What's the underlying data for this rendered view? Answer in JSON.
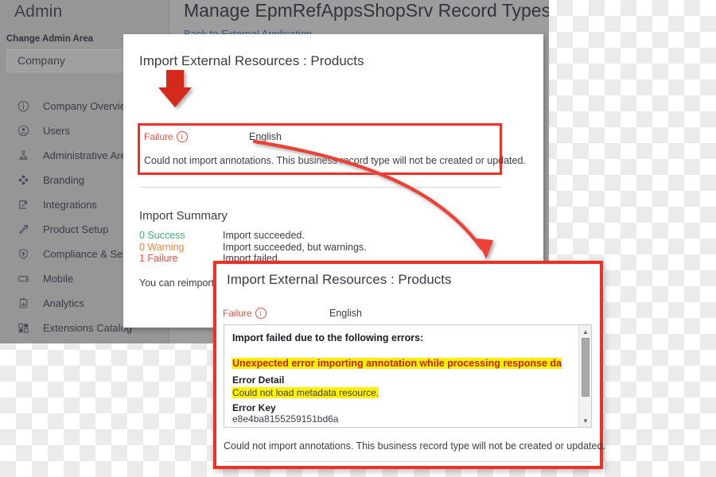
{
  "app": {
    "sidebar": {
      "title": "Admin",
      "change_area_label": "Change Admin Area",
      "area_select_value": "Company",
      "items": [
        {
          "label": "Company Overview",
          "icon": "info-circle-icon"
        },
        {
          "label": "Users",
          "icon": "user-circle-icon"
        },
        {
          "label": "Administrative Areas",
          "icon": "org-areas-icon"
        },
        {
          "label": "Branding",
          "icon": "branding-icon"
        },
        {
          "label": "Integrations",
          "icon": "integrations-icon"
        },
        {
          "label": "Product Setup",
          "icon": "wrench-icon"
        },
        {
          "label": "Compliance & Security",
          "icon": "shield-icon"
        },
        {
          "label": "Mobile",
          "icon": "mobile-icon"
        },
        {
          "label": "Analytics",
          "icon": "clipboard-chart-icon"
        },
        {
          "label": "Extensions Catalog",
          "icon": "extensions-grid-icon"
        }
      ]
    },
    "main": {
      "page_title": "Manage EpmRefAppsShopSrv  Record Types",
      "back_link": "Back to External Application"
    }
  },
  "upper_dialog": {
    "title": "Import External Resources : Products",
    "status_label": "Failure",
    "status_icon": "info-circle-icon",
    "language": "English",
    "failure_message": "Could not import annotations. This business record type will not be created or updated.",
    "summary": {
      "heading": "Import Summary",
      "rows": [
        {
          "count": "0 Success",
          "description": "Import succeeded.",
          "color": "#3fae7a"
        },
        {
          "count": "0 Warning",
          "description": "Import succeeded, but warnings.",
          "color": "#f0853c"
        },
        {
          "count": "1 Failure",
          "description": "Import failed.",
          "color": "#e8503f"
        }
      ]
    },
    "reimport_note": "You can reimport at any time if metadata or annotations change in the future."
  },
  "lower_dialog": {
    "title": "Import External Resources : Products",
    "status_label": "Failure",
    "status_icon": "info-circle-icon",
    "language": "English",
    "errors_heading": "Import failed due to the following errors:",
    "error_main": "Unexpected error importing annotation while processing response da",
    "error_detail_title": "Error Detail",
    "error_detail_value": "Could not load metadata resource.",
    "error_key_title": "Error Key",
    "error_key_value": "e8e4ba8155259151bd6a",
    "footer_message": "Could not import annotations. This business record type will not be created or updated.",
    "scrollbar": {
      "up_icon": "triangle-up-icon",
      "down_icon": "triangle-down-icon"
    }
  },
  "annotations": {
    "highlight_color": "#ee3124",
    "marker_color": "#d32a1b",
    "down_arrow_name": "red-down-arrow-annotation",
    "curved_arrow_name": "red-curved-arrow-annotation"
  }
}
